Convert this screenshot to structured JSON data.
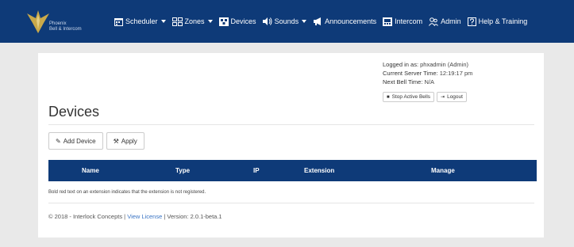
{
  "brand": {
    "line1": "Phoenix",
    "line2": "Bell & Intercom"
  },
  "nav": [
    {
      "label": "Scheduler",
      "icon": "calendar-icon",
      "caret": true
    },
    {
      "label": "Zones",
      "icon": "zones-icon",
      "caret": true
    },
    {
      "label": "Devices",
      "icon": "devices-icon",
      "caret": false
    },
    {
      "label": "Sounds",
      "icon": "speaker-icon",
      "caret": true
    },
    {
      "label": "Announcements",
      "icon": "megaphone-icon",
      "caret": false
    },
    {
      "label": "Intercom",
      "icon": "intercom-icon",
      "caret": false
    },
    {
      "label": "Admin",
      "icon": "users-icon",
      "caret": false
    },
    {
      "label": "Help & Training",
      "icon": "help-icon",
      "caret": false
    }
  ],
  "session": {
    "logged_in_label": "Logged in as:",
    "logged_in_value": "phxadmin (Admin)",
    "server_time_label": "Current Server Time:",
    "server_time_value": "12:19:17 pm",
    "next_bell_label": "Next Bell Time:",
    "next_bell_value": "N/A",
    "stop_bells_label": "Stop Active Bells",
    "logout_label": "Logout"
  },
  "page": {
    "title": "Devices",
    "add_device_label": "Add Device",
    "apply_label": "Apply"
  },
  "table": {
    "columns": [
      "Name",
      "Type",
      "IP",
      "Extension",
      "Manage"
    ]
  },
  "note": "Bold red text on an extension indicates that the extension is not registered.",
  "footer": {
    "copyright": "© 2018 - Interlock Concepts |",
    "license_link": "View License",
    "version": "| Version: 2.0.1-beta.1"
  },
  "colors": {
    "navbar": "#0e3a78",
    "table_header": "#0e3a78",
    "link": "#3a74c4"
  }
}
